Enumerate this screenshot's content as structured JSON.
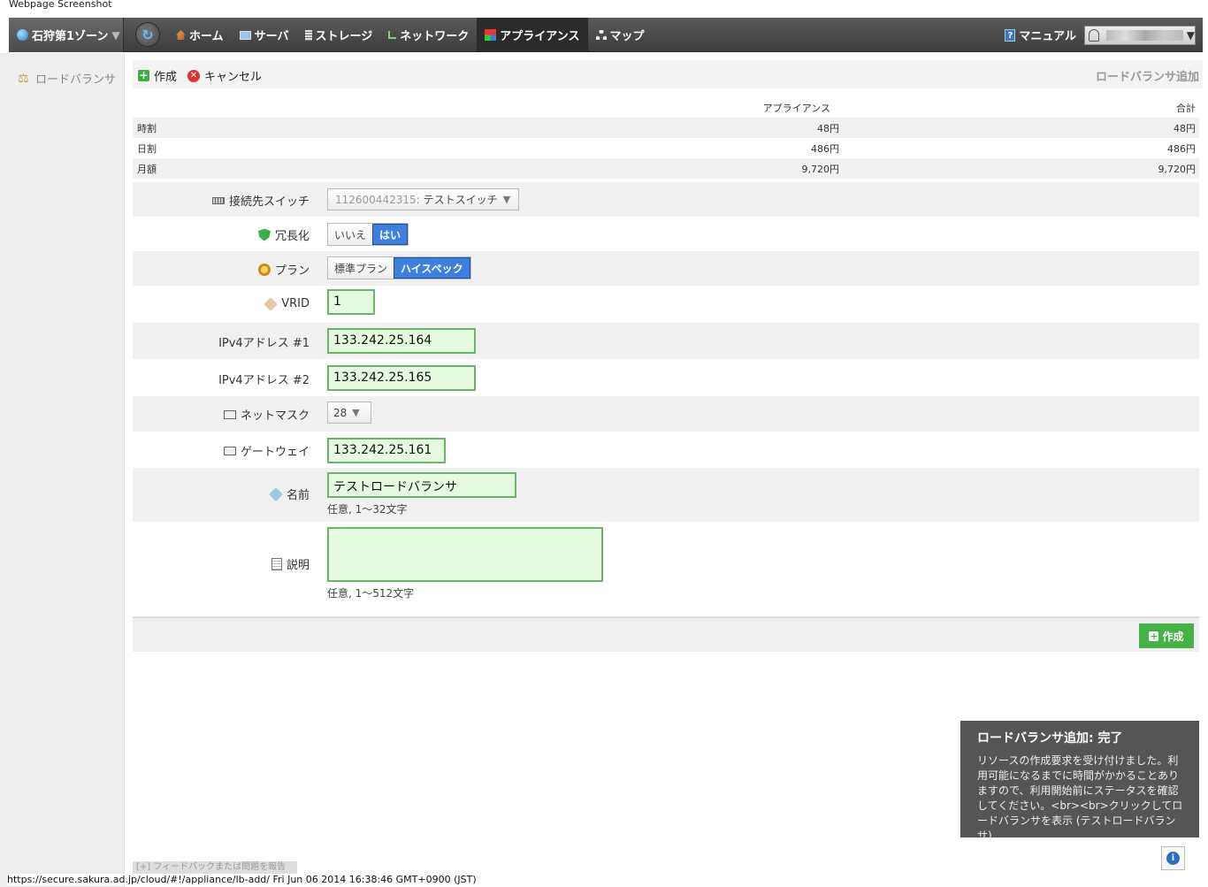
{
  "caption": "Webpage Screenshot",
  "topbar": {
    "zone_label": "石狩第1ゾーン",
    "nav": [
      {
        "label": "ホーム",
        "icon": "home-icon"
      },
      {
        "label": "サーバ",
        "icon": "server-icon"
      },
      {
        "label": "ストレージ",
        "icon": "storage-icon"
      },
      {
        "label": "ネットワーク",
        "icon": "network-icon"
      },
      {
        "label": "アプライアンス",
        "icon": "appliance-icon",
        "active": true
      },
      {
        "label": "マップ",
        "icon": "map-icon"
      }
    ],
    "manual_label": "マニュアル"
  },
  "sidebar": {
    "item_label": "ロードバランサ"
  },
  "toolbar": {
    "create_label": "作成",
    "cancel_label": "キャンセル",
    "page_title": "ロードバランサ追加"
  },
  "price": {
    "headers": [
      "アプライアンス",
      "合計"
    ],
    "rows": [
      {
        "label": "時割",
        "appliance": "48円",
        "total": "48円"
      },
      {
        "label": "日割",
        "appliance": "486円",
        "total": "486円"
      },
      {
        "label": "月額",
        "appliance": "9,720円",
        "total": "9,720円"
      }
    ]
  },
  "form": {
    "switch_label": "接続先スイッチ",
    "switch_value_id": "112600442315:",
    "switch_value_name": "テストスイッチ",
    "redundancy_label": "冗長化",
    "redundancy_no": "いいえ",
    "redundancy_yes": "はい",
    "plan_label": "プラン",
    "plan_standard": "標準プラン",
    "plan_high": "ハイスペック",
    "vrid_label": "VRID",
    "vrid_value": "1",
    "ip1_label": "IPv4アドレス #1",
    "ip1_value": "133.242.25.164",
    "ip2_label": "IPv4アドレス #2",
    "ip2_value": "133.242.25.165",
    "netmask_label": "ネットマスク",
    "netmask_value": "28",
    "gateway_label": "ゲートウェイ",
    "gateway_value": "133.242.25.161",
    "name_label": "名前",
    "name_value": "テストロードバランサ",
    "name_hint": "任意, 1〜32文字",
    "desc_label": "説明",
    "desc_value": "",
    "desc_hint": "任意, 1〜512文字",
    "submit_label": "作成"
  },
  "notice": {
    "title": "ロードバランサ追加: 完了",
    "body": "リソースの作成要求を受け付けました。利用可能になるまでに時間がかかることありますので、利用開始前にステータスを確認してください。<br><br>クリックしてロードバランサを表示 (テストロードバランサ)"
  },
  "feedback_label": "[+] フィードバックまたは問題を報告",
  "statusbar": "https://secure.sakura.ad.jp/cloud/#!/appliance/lb-add/ Fri Jun 06 2014 16:38:46 GMT+0900 (JST)",
  "colors": {
    "accent_blue": "#3d7fde",
    "input_green": "#e4fbe0",
    "create_green": "#44b244",
    "notice_bg": "#555555"
  }
}
